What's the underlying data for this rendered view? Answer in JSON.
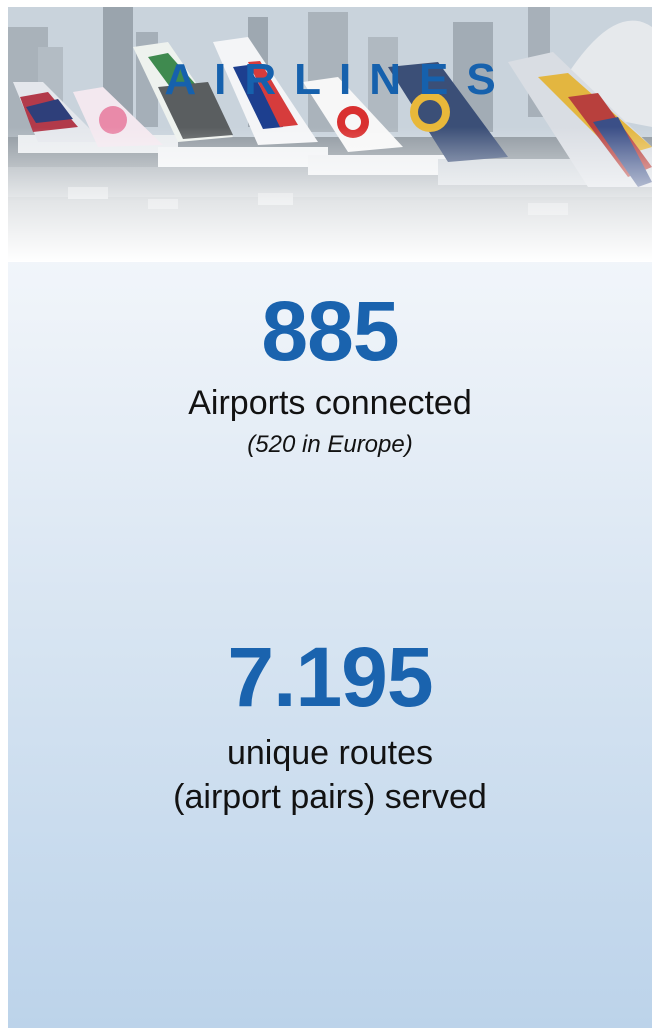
{
  "header": {
    "title": "AIRLINES",
    "image": "airline-tails-photo"
  },
  "stats": [
    {
      "value": "885",
      "label": "Airports connected",
      "note": "(520 in Europe)"
    },
    {
      "value": "7.195",
      "label_line1": "unique routes",
      "label_line2": "(airport pairs) served"
    }
  ],
  "colors": {
    "accent": "#1661ad",
    "text": "#121212",
    "background_bottom": "#bcd3ea"
  }
}
